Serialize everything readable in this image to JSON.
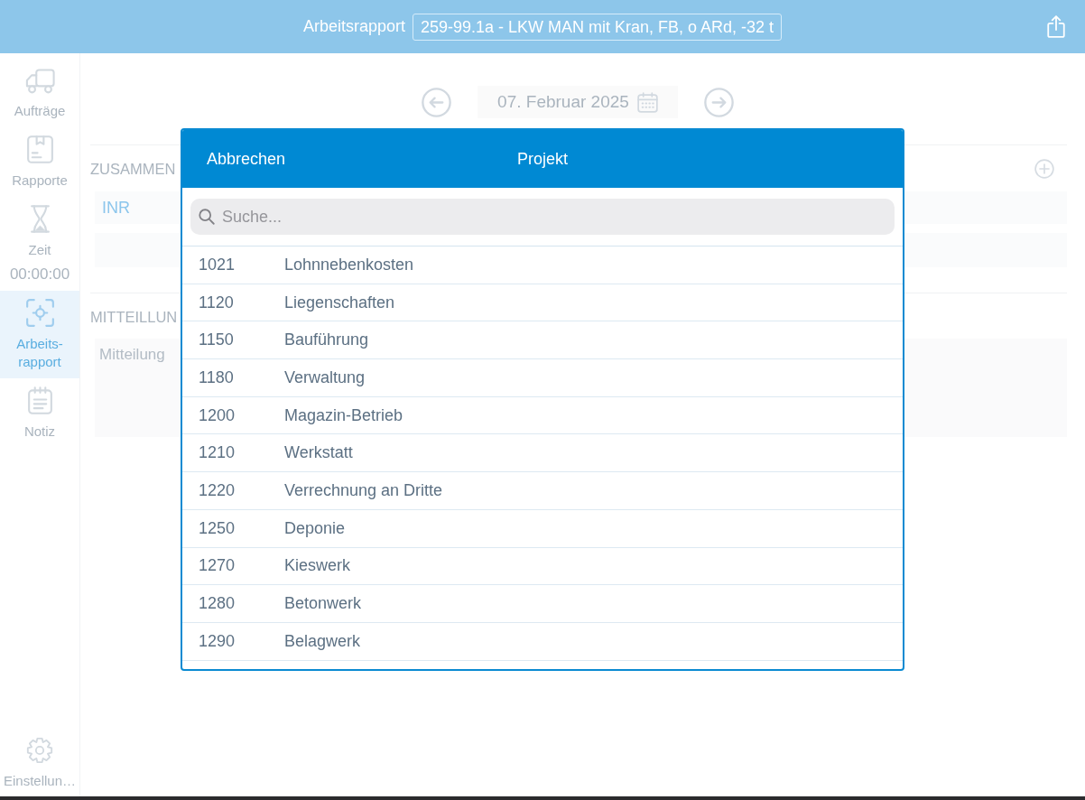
{
  "top_bar": {
    "title": "Arbeitsrapport",
    "vehicle": "259-99.1a - LKW MAN mit Kran, FB, o ARd, -32 t"
  },
  "sidebar": {
    "items": [
      {
        "label": "Aufträge",
        "selected": false
      },
      {
        "label": "Rapporte",
        "selected": false
      },
      {
        "label": "Zeit",
        "timer": "00:00:00",
        "selected": false
      },
      {
        "label": "Arbeits-rapport",
        "selected": true
      },
      {
        "label": "Notiz",
        "selected": false
      }
    ],
    "footer_item": {
      "label": "Einstellun…",
      "selected": false
    }
  },
  "report": {
    "date": "07. Februar 2025",
    "summary": {
      "heading": "ZUSAMMEN",
      "row_label": "INR"
    },
    "messages": {
      "heading": "MITTEILLUN",
      "placeholder": "Mitteilung"
    }
  },
  "picker": {
    "cancel": "Abbrechen",
    "title": "Projekt",
    "search": {
      "placeholder": "Suche..."
    },
    "rows": [
      {
        "number": "1021",
        "name": "Lohnnebenkosten",
        "selected": false
      },
      {
        "number": "1120",
        "name": "Liegenschaften",
        "selected": false
      },
      {
        "number": "1150",
        "name": "Bauführung",
        "selected": false
      },
      {
        "number": "1180",
        "name": "Verwaltung",
        "selected": false
      },
      {
        "number": "1200",
        "name": "Magazin-Betrieb",
        "selected": false
      },
      {
        "number": "1210",
        "name": "Werkstatt",
        "selected": false
      },
      {
        "number": "1220",
        "name": "Verrechnung an Dritte",
        "selected": false
      },
      {
        "number": "1250",
        "name": "Deponie",
        "selected": false
      },
      {
        "number": "1270",
        "name": "Kieswerk",
        "selected": false
      },
      {
        "number": "1280",
        "name": "Betonwerk",
        "selected": false
      },
      {
        "number": "1290",
        "name": "Belagwerk",
        "selected": false
      }
    ]
  }
}
